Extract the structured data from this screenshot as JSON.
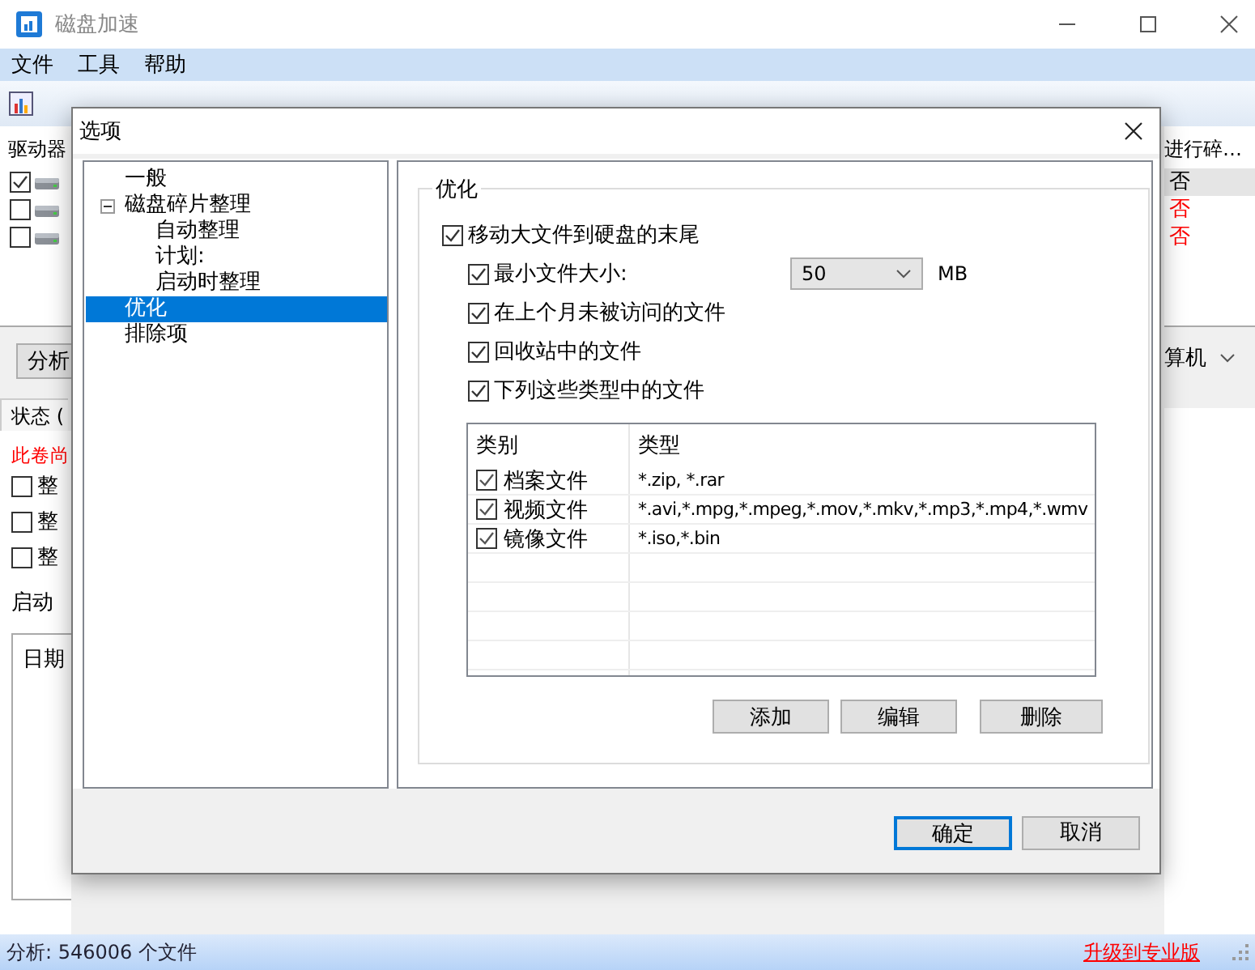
{
  "window": {
    "title": "磁盘加速"
  },
  "menu": [
    "文件",
    "工具",
    "帮助"
  ],
  "drive_list": {
    "column_1": "驱动器",
    "column_2": "进行碎…",
    "rows": [
      {
        "checked": true,
        "selected": true,
        "status": "否",
        "color": "#000000"
      },
      {
        "checked": false,
        "selected": false,
        "status": "否",
        "color": "#ff0000"
      },
      {
        "checked": false,
        "selected": false,
        "status": "否",
        "color": "#ff0000"
      }
    ]
  },
  "analyze_button": "分析",
  "computer_select": "算机",
  "status_tab": "状态 (",
  "volume_notice": "此卷尚",
  "defrag_options": [
    {
      "label": "整",
      "checked": false
    },
    {
      "label": "整",
      "checked": false
    },
    {
      "label": "整",
      "checked": false
    }
  ],
  "boot_label": "启动",
  "history_table": {
    "column_1": "日期"
  },
  "status_bar": {
    "text": "分析: 546006 个文件",
    "upgrade_link": "升级到专业版"
  },
  "dialog": {
    "title": "选项",
    "tree": [
      {
        "label": "一般",
        "selected": false
      },
      {
        "label": "磁盘碎片整理",
        "selected": false,
        "expanded": true,
        "children": [
          {
            "label": "自动整理",
            "selected": false
          },
          {
            "label": "计划:",
            "selected": false
          },
          {
            "label": "启动时整理",
            "selected": false
          }
        ]
      },
      {
        "label": "优化",
        "selected": true
      },
      {
        "label": "排除项",
        "selected": false
      }
    ],
    "group_title": "优化",
    "move_large": {
      "label": "移动大文件到硬盘的末尾",
      "checked": true
    },
    "sub_options": [
      {
        "kind": "size",
        "label": "最小文件大小:",
        "checked": true,
        "value": "50",
        "unit": "MB"
      },
      {
        "kind": "check",
        "label": "在上个月未被访问的文件",
        "checked": true
      },
      {
        "kind": "check",
        "label": "回收站中的文件",
        "checked": true
      },
      {
        "kind": "check",
        "label": "下列这些类型中的文件",
        "checked": true
      }
    ],
    "types_table": {
      "columns": [
        "类别",
        "类型"
      ],
      "rows": [
        {
          "category": "档案文件",
          "checked": true,
          "types": "*.zip, *.rar"
        },
        {
          "category": "视频文件",
          "checked": true,
          "types": "*.avi,*.mpg,*.mpeg,*.mov,*.mkv,*.mp3,*.mp4,*.wmv"
        },
        {
          "category": "镜像文件",
          "checked": true,
          "types": "*.iso,*.bin"
        }
      ]
    },
    "table_buttons": [
      "添加",
      "编辑",
      "删除"
    ],
    "buttons": [
      {
        "label": "确定",
        "default": true
      },
      {
        "label": "取消",
        "default": false
      }
    ]
  }
}
